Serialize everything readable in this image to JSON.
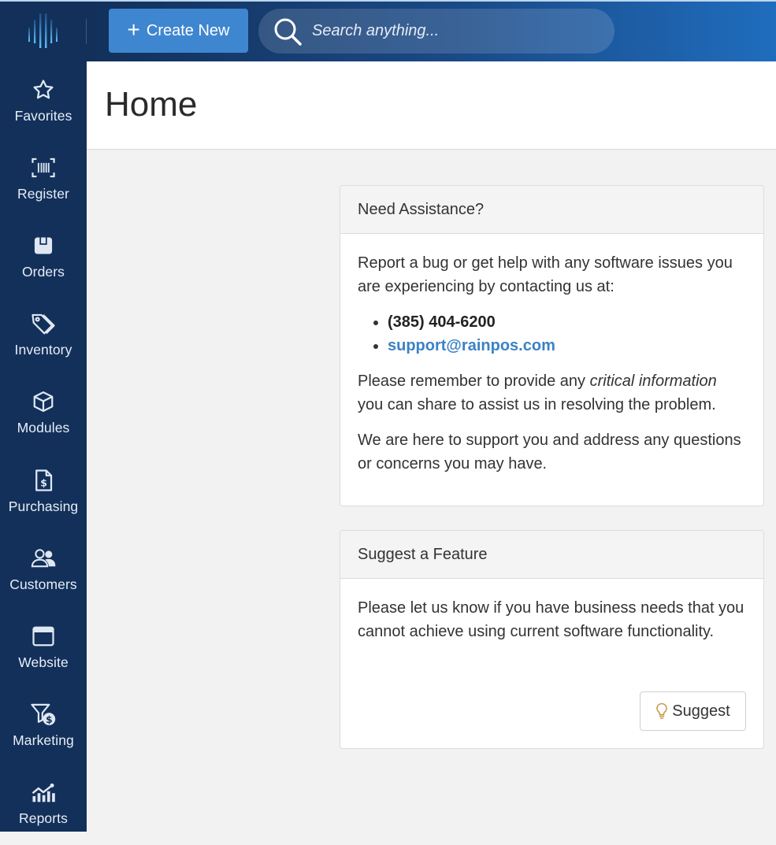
{
  "sidebar": {
    "items": [
      {
        "label": "Favorites",
        "icon": "star-icon"
      },
      {
        "label": "Register",
        "icon": "barcode-scan-icon"
      },
      {
        "label": "Orders",
        "icon": "box-icon"
      },
      {
        "label": "Inventory",
        "icon": "tags-icon"
      },
      {
        "label": "Modules",
        "icon": "cube-icon"
      },
      {
        "label": "Purchasing",
        "icon": "invoice-dollar-icon"
      },
      {
        "label": "Customers",
        "icon": "users-icon"
      },
      {
        "label": "Website",
        "icon": "browser-window-icon"
      },
      {
        "label": "Marketing",
        "icon": "funnel-dollar-icon"
      },
      {
        "label": "Reports",
        "icon": "chart-line-icon"
      }
    ]
  },
  "topbar": {
    "create_label": "Create New",
    "search_placeholder": "Search anything..."
  },
  "page": {
    "title": "Home"
  },
  "assist": {
    "title": "Need Assistance?",
    "intro": "Report a bug or get help with any software issues you are experiencing by contacting us at:",
    "phone": "(385) 404-6200",
    "email": "support@rainpos.com",
    "remember_pre": "Please remember to provide any ",
    "remember_em": "critical information",
    "remember_post": " you can share to assist us in resolving the problem.",
    "support": "We are here to support you and address any questions or concerns you may have."
  },
  "feature": {
    "title": "Suggest a Feature",
    "body": "Please let us know if you have business needs that you cannot achieve using current software functionality.",
    "button_label": "Suggest"
  },
  "colors": {
    "sidebar_bg": "#12305a",
    "accent": "#3f86d0",
    "link": "#3b82c4"
  }
}
